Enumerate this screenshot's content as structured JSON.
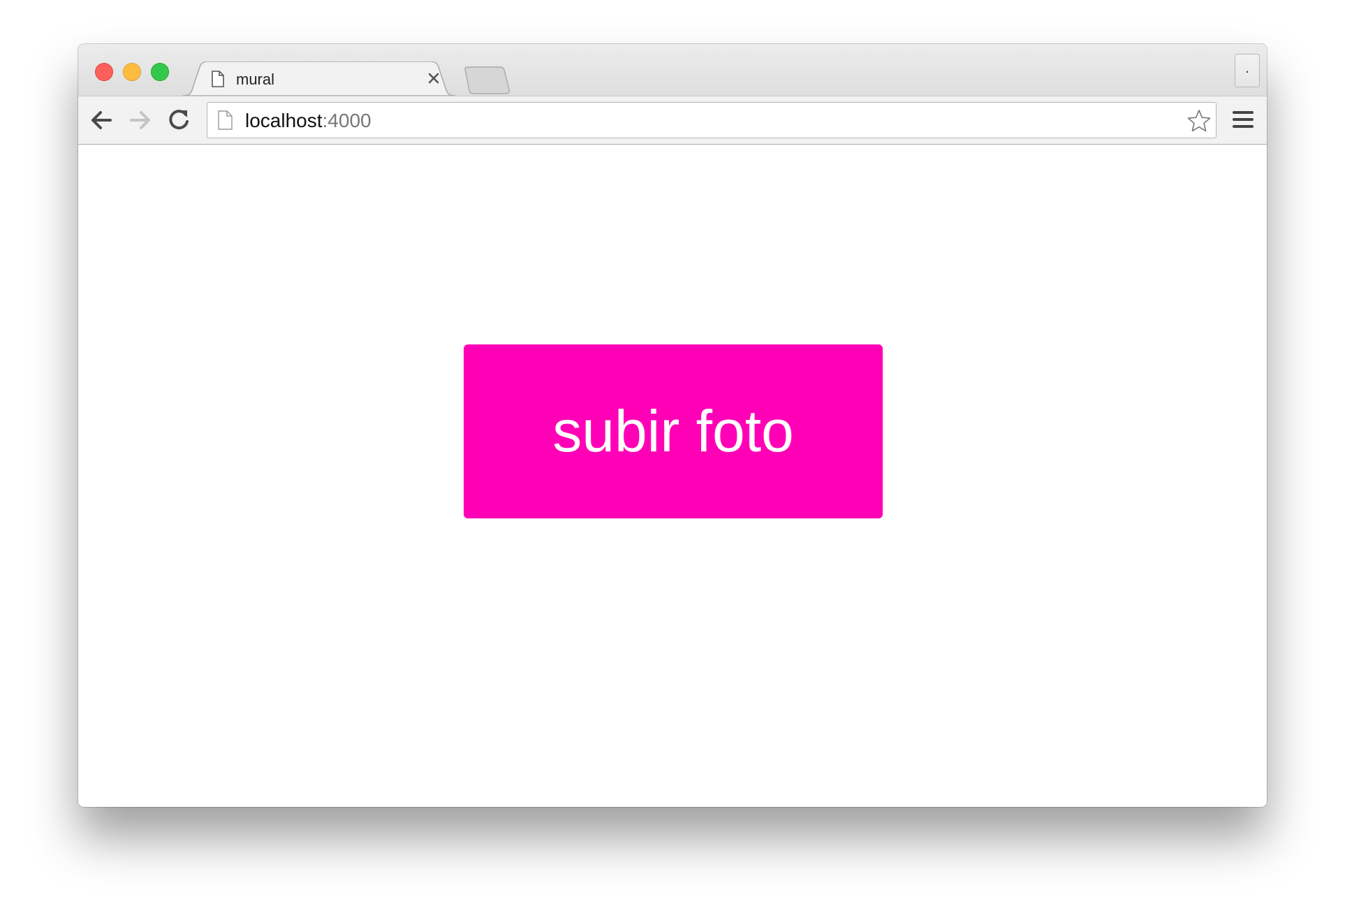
{
  "browser": {
    "tab": {
      "title": "mural"
    },
    "profile_button_label": ".",
    "address_bar": {
      "host": "localhost",
      "port": ":4000"
    }
  },
  "page": {
    "upload_button_label": "subir foto",
    "upload_button_color": "#ff00b7"
  },
  "icons": {
    "close": "close-icon",
    "minimize": "minimize-icon",
    "maximize": "maximize-icon",
    "tab_page": "page-icon",
    "tab_close": "close-icon",
    "back": "arrow-left-icon",
    "forward": "arrow-right-icon",
    "reload": "reload-icon",
    "star": "star-icon",
    "menu": "hamburger-menu-icon"
  }
}
